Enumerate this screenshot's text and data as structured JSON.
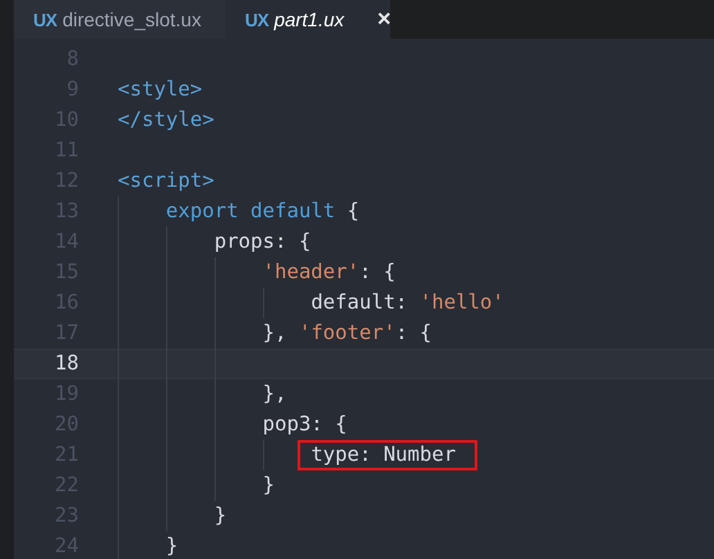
{
  "tabs": [
    {
      "badge": "UX",
      "label": "directive_slot.ux",
      "selected": false
    },
    {
      "badge": "UX",
      "label": "part1.ux",
      "selected": true,
      "close": "×"
    }
  ],
  "lines": [
    {
      "number": "8",
      "current": false
    },
    {
      "number": "9",
      "current": false,
      "highlighted": false,
      "tokens": [
        {
          "kind": "tag",
          "text": "<style>"
        }
      ]
    },
    {
      "number": "10",
      "current": false,
      "highlighted": false,
      "tokens": [
        {
          "kind": "tag",
          "text": "</style>"
        }
      ]
    },
    {
      "number": "11",
      "current": false
    },
    {
      "number": "12",
      "current": false,
      "highlighted": false,
      "tokens": [
        {
          "kind": "tag",
          "text": "<script>"
        }
      ]
    },
    {
      "number": "13",
      "current": false,
      "highlighted": false,
      "tokens": [
        {
          "kind": "keyword",
          "text": "    export default"
        },
        {
          "kind": "plain",
          "text": " {"
        }
      ]
    },
    {
      "number": "14",
      "current": false,
      "highlighted": false,
      "tokens": [
        {
          "kind": "plain",
          "text": "        props: {"
        }
      ]
    },
    {
      "number": "15",
      "current": false,
      "highlighted": false,
      "tokens": [
        {
          "kind": "string",
          "text": "            'header'"
        },
        {
          "kind": "plain",
          "text": ": {"
        }
      ]
    },
    {
      "number": "16",
      "current": false,
      "highlighted": false,
      "tokens": [
        {
          "kind": "plain",
          "text": "                default: "
        },
        {
          "kind": "string",
          "text": "'hello'"
        }
      ]
    },
    {
      "number": "17",
      "current": false,
      "highlighted": false,
      "tokens": [
        {
          "kind": "plain",
          "text": "            }, "
        },
        {
          "kind": "string",
          "text": "'footer'"
        },
        {
          "kind": "plain",
          "text": ": {"
        }
      ]
    },
    {
      "number": "18",
      "current": true
    },
    {
      "number": "19",
      "current": false,
      "highlighted": false,
      "tokens": [
        {
          "kind": "plain",
          "text": "            },"
        }
      ]
    },
    {
      "number": "20",
      "current": false,
      "highlighted": false,
      "tokens": [
        {
          "kind": "plain",
          "text": "            pop3: {"
        }
      ]
    },
    {
      "number": "21",
      "current": false,
      "highlighted": true,
      "tokens": [
        {
          "kind": "plain",
          "text": "                type: Number"
        }
      ]
    },
    {
      "number": "22",
      "current": false,
      "highlighted": false,
      "tokens": [
        {
          "kind": "plain",
          "text": "            }"
        }
      ]
    },
    {
      "number": "23",
      "current": false,
      "highlighted": false,
      "tokens": [
        {
          "kind": "plain",
          "text": "        }"
        }
      ]
    },
    {
      "number": "24",
      "current": false,
      "highlighted": false,
      "tokens": [
        {
          "kind": "plain",
          "text": "    }"
        }
      ]
    }
  ]
}
